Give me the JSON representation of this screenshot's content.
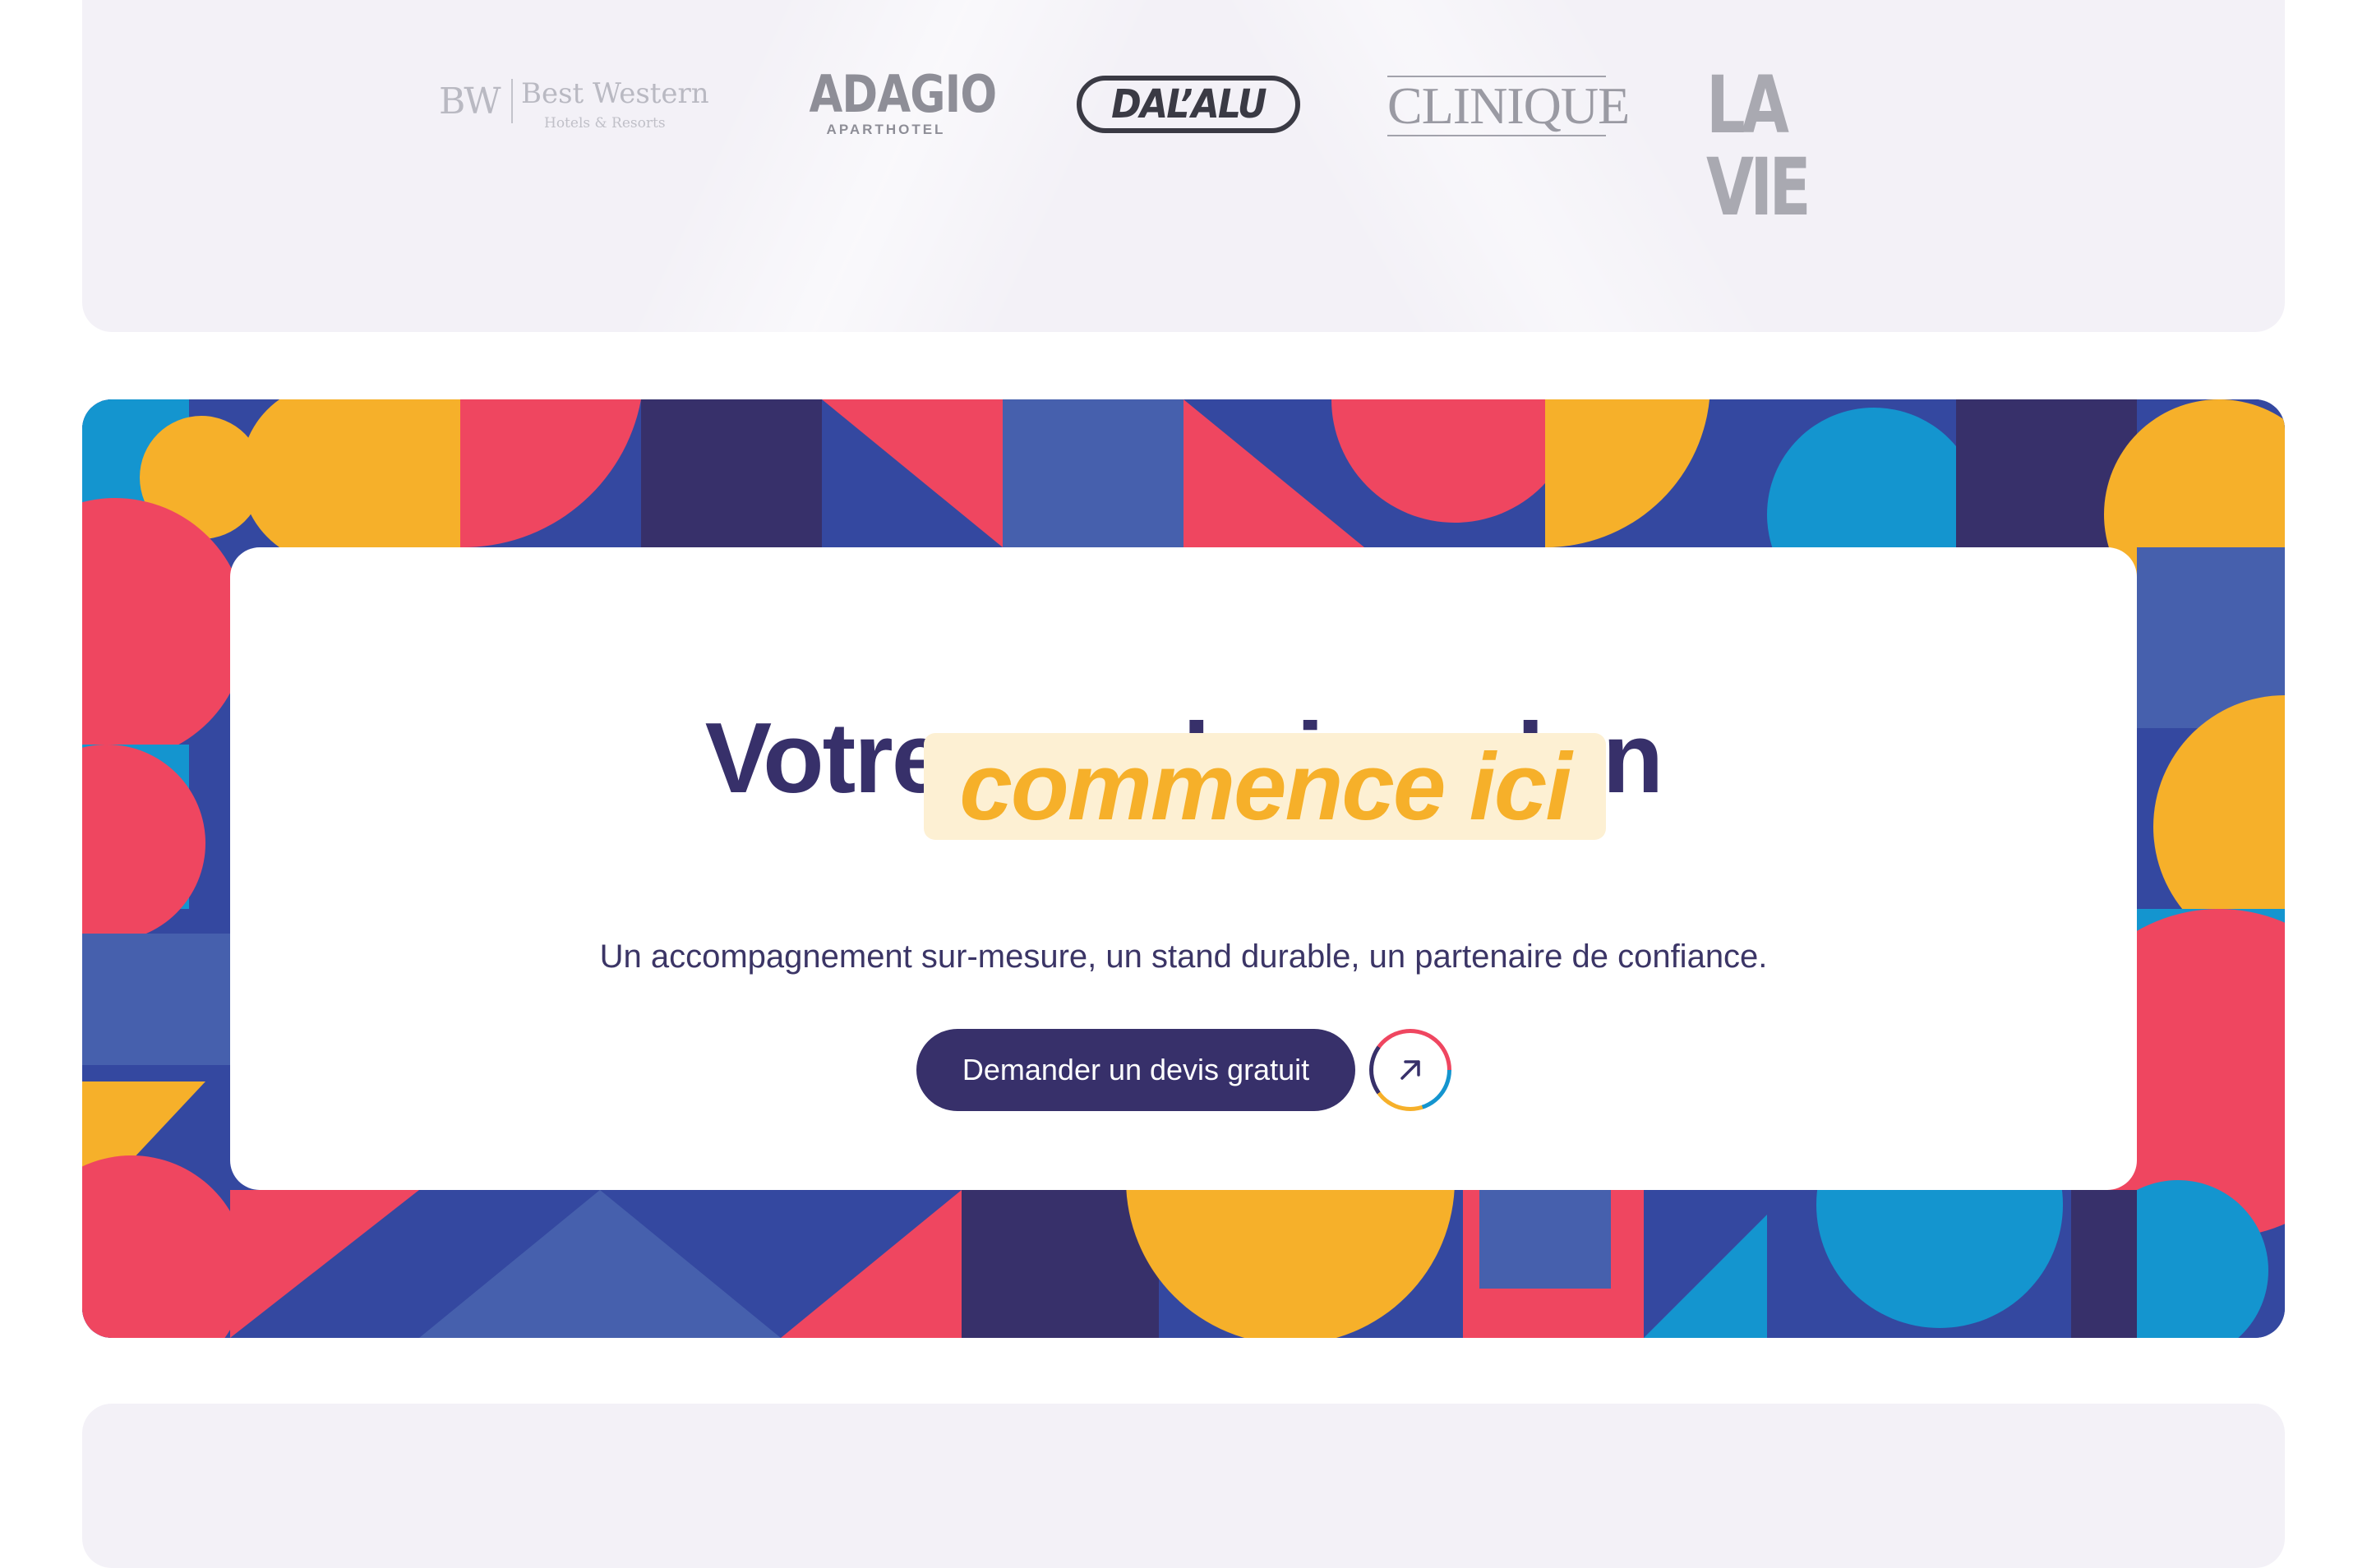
{
  "logos": {
    "best_western": {
      "mark": "BW",
      "name": "Best Western",
      "sub": "Hotels & Resorts"
    },
    "adagio": {
      "name": "ADAGIO",
      "sub": "APARTHOTEL"
    },
    "dalalu": {
      "name": "DAL’ALU"
    },
    "clinique": {
      "name": "CLINIQUE"
    },
    "lavie": {
      "name": "LA VIE"
    }
  },
  "cta": {
    "title": "Votre prochain salon",
    "highlight": "commence ici",
    "subtitle": "Un accompagnement sur-mesure, un stand durable, un partenaire de confiance.",
    "button_label": "Demander un devis gratuit",
    "arrow_icon": "arrow-up-right-icon"
  },
  "colors": {
    "navy": "#37306a",
    "yellow": "#f6b02a",
    "highlight_bg": "#fdf0d3",
    "red": "#ef4660",
    "blue": "#3448a0",
    "cyan": "#1495cf",
    "panel_bg": "#f3f1f7"
  }
}
